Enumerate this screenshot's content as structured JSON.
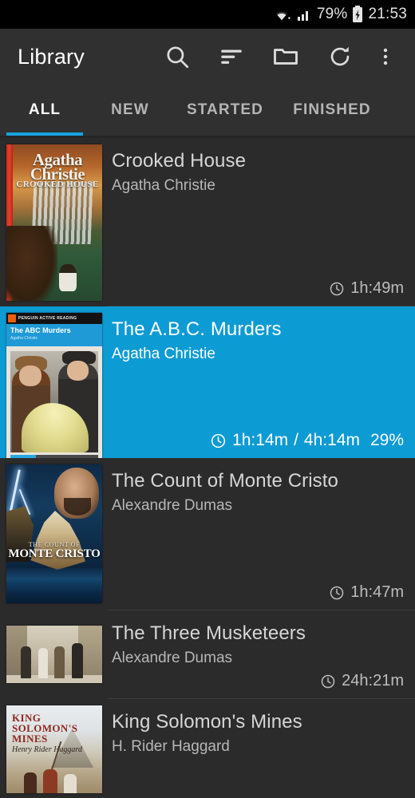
{
  "statusbar": {
    "wifi_icon": "wifi-icon",
    "signal_icon": "cellular-signal-icon",
    "battery_percent": "79%",
    "battery_icon": "battery-charging-icon",
    "clock": "21:53"
  },
  "toolbar": {
    "title": "Library",
    "actions": [
      {
        "name": "search-icon",
        "label": "Search"
      },
      {
        "name": "sort-icon",
        "label": "Sort"
      },
      {
        "name": "folder-icon",
        "label": "Folders"
      },
      {
        "name": "refresh-icon",
        "label": "Refresh"
      },
      {
        "name": "overflow-menu-icon",
        "label": "More options"
      }
    ]
  },
  "tabs": {
    "active_index": 0,
    "items": [
      {
        "label": "ALL"
      },
      {
        "label": "NEW"
      },
      {
        "label": "STARTED"
      },
      {
        "label": "FINISHED"
      }
    ],
    "indicator_color": "#17A3DE"
  },
  "colors": {
    "background": "#2b2b2b",
    "toolbar": "#303030",
    "selected_row": "#0D9BD4",
    "accent": "#17A3DE",
    "divider": "#3c3c3c",
    "title_text": "#d6d6d6",
    "author_text": "#b7b7b7",
    "duration_text": "#bdbdbd"
  },
  "library": {
    "items": [
      {
        "title": "Crooked House",
        "author": "Agatha Christie",
        "duration": "1h:49m",
        "elapsed": "",
        "percent": "",
        "selected": false,
        "cover_alt": "Crooked House cover",
        "cover_text": {
          "line1": "Agatha Christie",
          "line2": "CROOKED HOUSE"
        }
      },
      {
        "title": "The A.B.C. Murders",
        "author": "Agatha Christie",
        "duration": "4h:14m",
        "elapsed": "1h:14m",
        "separator": "/",
        "percent": "29%",
        "progress": 29,
        "selected": true,
        "cover_alt": "The A.B.C. Murders cover",
        "cover_text": {
          "imprint": "PENGUIN ACTIVE READING",
          "line1": "The ABC Murders",
          "line2": "Agatha Christie"
        }
      },
      {
        "title": "The Count of Monte Cristo",
        "author": "Alexandre Dumas",
        "duration": "1h:47m",
        "elapsed": "",
        "percent": "",
        "selected": false,
        "cover_alt": "The Count of Monte Cristo cover",
        "cover_text": {
          "line1": "THE COUNT OF",
          "line2": "MONTE CRISTO"
        }
      },
      {
        "title": "The Three Musketeers",
        "author": "Alexandre Dumas",
        "duration": "24h:21m",
        "elapsed": "",
        "percent": "",
        "selected": false,
        "cover_alt": "The Three Musketeers cover",
        "cover_text": {
          "line1": "",
          "line2": ""
        }
      },
      {
        "title": "King Solomon's Mines",
        "author": "H. Rider Haggard",
        "duration": "",
        "elapsed": "",
        "percent": "",
        "selected": false,
        "cover_alt": "King Solomon's Mines cover",
        "cover_text": {
          "line1": "KING SOLOMON'S MINES",
          "line2": "Henry Rider Haggard"
        }
      }
    ]
  }
}
